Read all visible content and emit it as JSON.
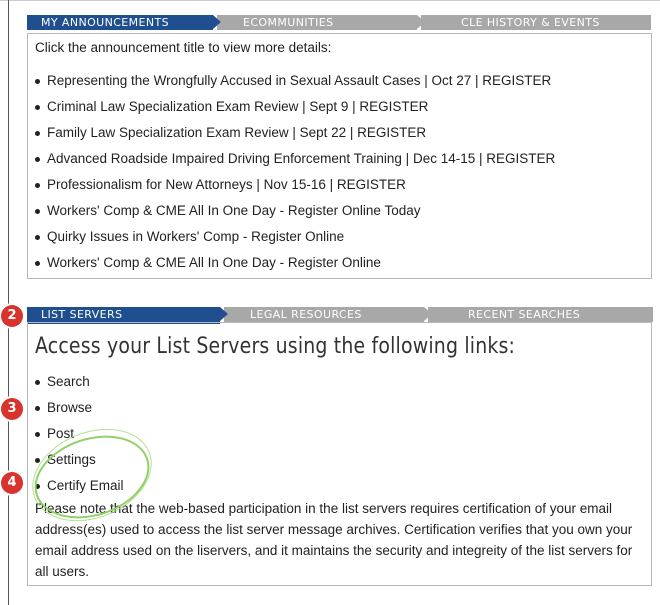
{
  "top_tabs": [
    {
      "label": "MY ANNOUNCEMENTS",
      "active": true
    },
    {
      "label": "ECOMMUNITIES",
      "active": false
    },
    {
      "label": "CLE HISTORY & EVENTS",
      "active": false
    }
  ],
  "announcements": {
    "intro": "Click the announcement title to view more details:",
    "items": [
      "Representing the Wrongfully Accused in Sexual Assault Cases | Oct 27 | REGISTER",
      "Criminal Law Specialization Exam Review | Sept 9 | REGISTER",
      "Family Law Specialization Exam Review | Sept 22 | REGISTER",
      "Advanced Roadside Impaired Driving Enforcement Training | Dec 14-15 | REGISTER",
      "Professionalism for New Attorneys | Nov 15-16 | REGISTER",
      "Workers' Comp & CME All In One Day - Register Online Today",
      "Quirky Issues in Workers' Comp - Register Online",
      "Workers' Comp & CME All In One Day - Register Online"
    ]
  },
  "bottom_tabs": [
    {
      "label": "LIST SERVERS",
      "active": true
    },
    {
      "label": "LEGAL RESOURCES",
      "active": false
    },
    {
      "label": "RECENT SEARCHES",
      "active": false
    }
  ],
  "list_servers": {
    "heading": "Access your List Servers using the following links:",
    "links": [
      "Search",
      "Browse",
      "Post",
      "Settings",
      "Certify Email"
    ],
    "note": "Please note that the web-based participation in the list servers requires certification of your email address(es) used to access the list server message archives. Certification verifies that you own your email address used on the liservers, and it maintains the security and integreity of the list servers for all users."
  },
  "markers": [
    "2",
    "3",
    "4"
  ],
  "colors": {
    "active_tab": "#1f4f8f",
    "inactive_tab": "#a8a8a8",
    "marker": "#d8332d",
    "highlight_ring": "#8fd068"
  }
}
